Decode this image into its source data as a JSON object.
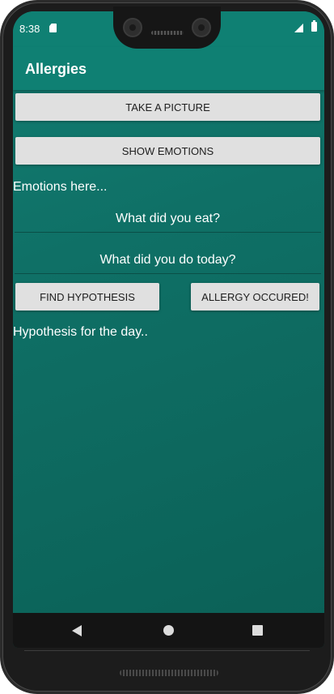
{
  "status_bar": {
    "time": "8:38",
    "sd_icon": "sd-card-icon",
    "signal_icon": "signal-icon",
    "battery_icon": "battery-icon"
  },
  "app_bar": {
    "title": "Allergies"
  },
  "buttons": {
    "take_picture": "TAKE A PICTURE",
    "show_emotions": "SHOW EMOTIONS",
    "find_hypothesis": "FIND HYPOTHESIS",
    "allergy_occured": "ALLERGY OCCURED!"
  },
  "texts": {
    "emotions_placeholder": "Emotions here...",
    "hypothesis_placeholder": "Hypothesis for the day.."
  },
  "inputs": {
    "what_did_you_eat": {
      "value": "",
      "placeholder": "What did you eat?"
    },
    "what_did_you_do": {
      "value": "",
      "placeholder": "What did you do today?"
    }
  },
  "nav_bar": {
    "back_icon": "back-triangle-icon",
    "home_icon": "home-circle-icon",
    "recents_icon": "recents-square-icon"
  },
  "colors": {
    "app_bar": "#0f8073",
    "background_top": "#127d72",
    "background_bottom": "#0b6056",
    "button": "#e0e0e0"
  }
}
